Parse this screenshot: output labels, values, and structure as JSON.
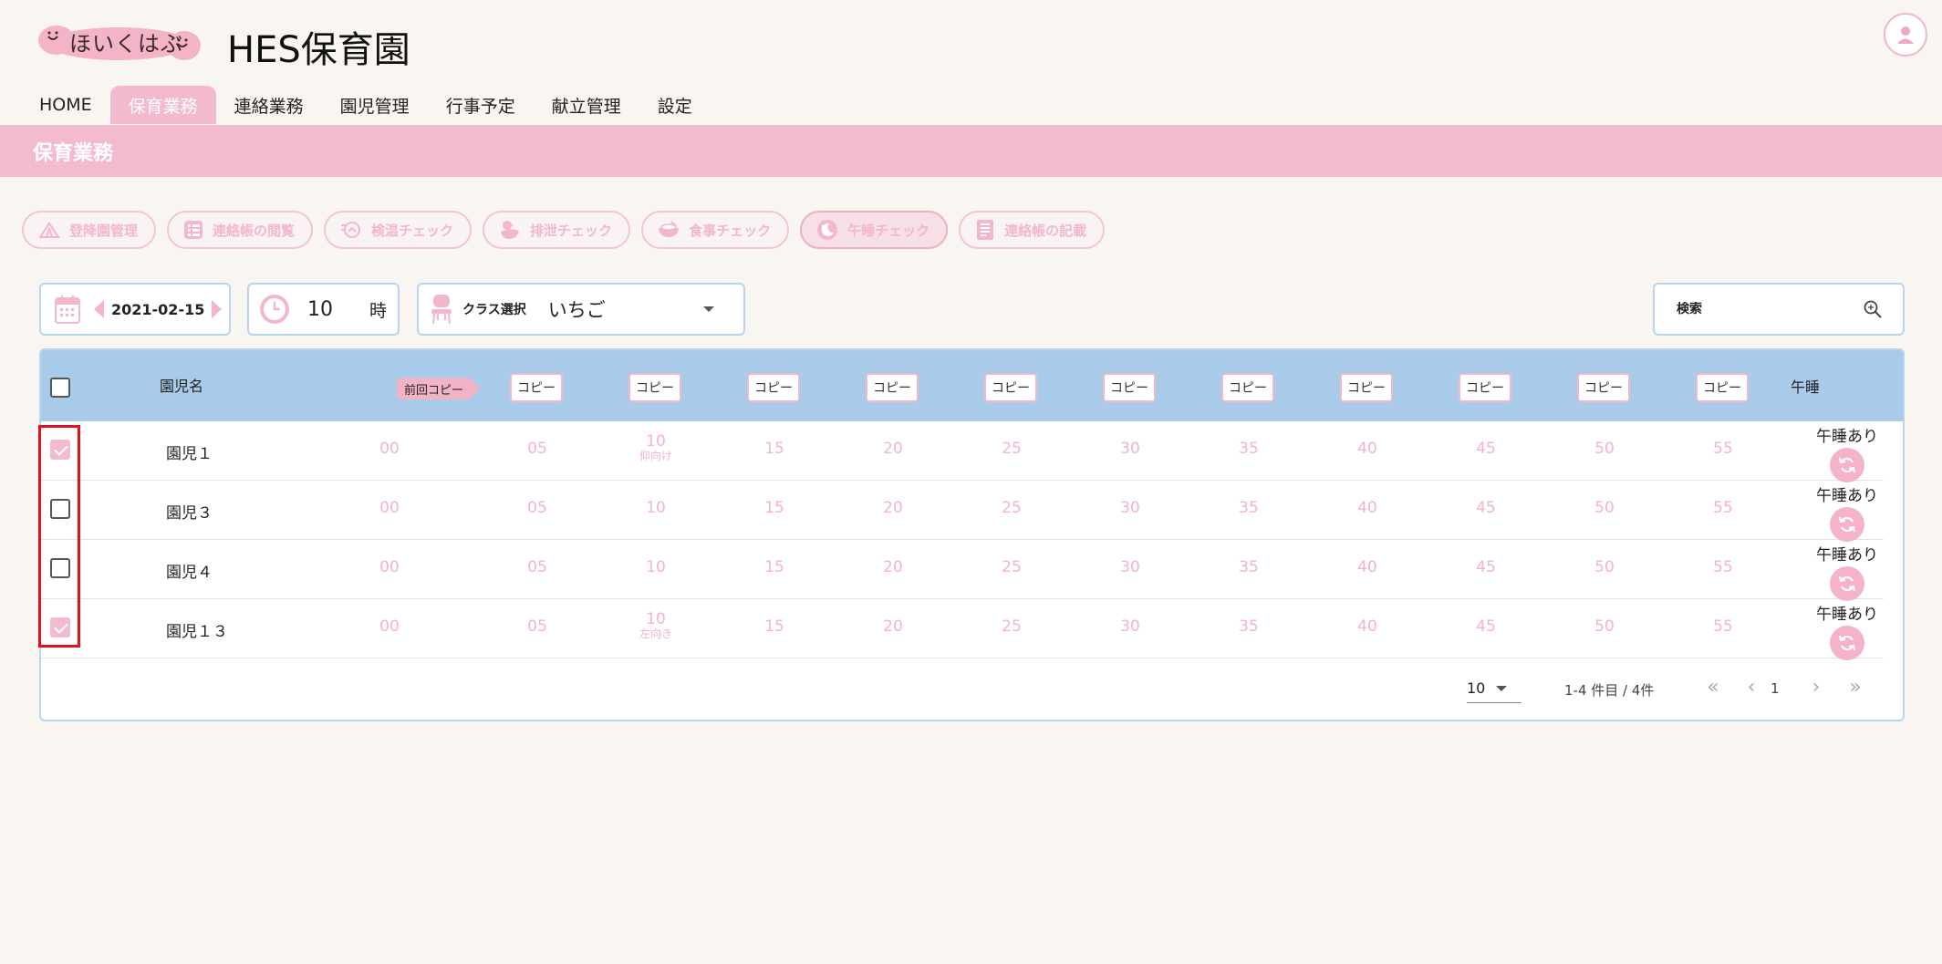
{
  "brand": {
    "logo_text": "ほいくはぶ",
    "site_title": "HES保育園"
  },
  "nav": {
    "items": [
      {
        "label": "HOME"
      },
      {
        "label": "保育業務"
      },
      {
        "label": "連絡業務"
      },
      {
        "label": "園児管理"
      },
      {
        "label": "行事予定"
      },
      {
        "label": "献立管理"
      },
      {
        "label": "設定"
      }
    ],
    "active_index": 1
  },
  "section": {
    "title": "保育業務"
  },
  "tools": [
    {
      "label": "登降園管理",
      "icon": "tent-icon"
    },
    {
      "label": "連絡帳の閲覧",
      "icon": "list-icon"
    },
    {
      "label": "検温チェック",
      "icon": "thermometer-icon"
    },
    {
      "label": "排泄チェック",
      "icon": "duck-icon"
    },
    {
      "label": "食事チェック",
      "icon": "bowl-icon"
    },
    {
      "label": "午睡チェック",
      "icon": "moon-icon"
    },
    {
      "label": "連絡帳の記載",
      "icon": "notebook-icon"
    }
  ],
  "controls": {
    "date": "2021-02-15",
    "hour_value": "10",
    "hour_unit": "時",
    "class_label": "クラス選択",
    "class_value": "いちご",
    "search_placeholder": "検索"
  },
  "table": {
    "header_name": "園児名",
    "prev_copy_label": "前回コピー",
    "copy_label": "コピー",
    "header_nap": "午睡",
    "slots": [
      "00",
      "05",
      "10",
      "15",
      "20",
      "25",
      "30",
      "35",
      "40",
      "45",
      "50",
      "55"
    ],
    "rows": [
      {
        "name": "園児１",
        "checked": true,
        "slot_notes": {
          "10": "仰向け"
        },
        "nap_status": "午睡あり"
      },
      {
        "name": "園児３",
        "checked": false,
        "slot_notes": {},
        "nap_status": "午睡あり"
      },
      {
        "name": "園児４",
        "checked": false,
        "slot_notes": {},
        "nap_status": "午睡あり"
      },
      {
        "name": "園児１３",
        "checked": true,
        "slot_notes": {
          "10": "左向き"
        },
        "nap_status": "午睡あり"
      }
    ]
  },
  "pagination": {
    "per_page": "10",
    "range_text": "1-4 件目 / 4件",
    "current_page": "1"
  },
  "colors": {
    "accent_pink": "#f4bacd",
    "header_blue": "#a9cbea",
    "border_blue": "#b8d4f0",
    "highlight_red": "#e0121b"
  }
}
